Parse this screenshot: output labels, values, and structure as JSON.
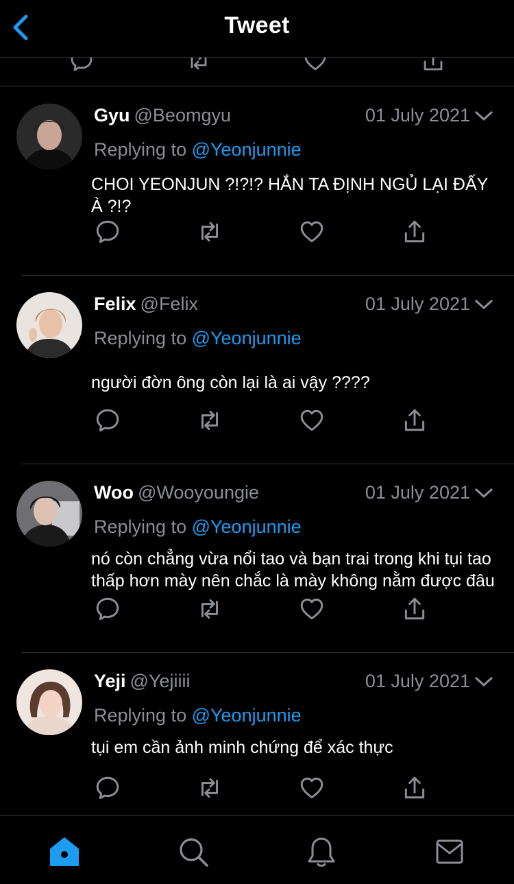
{
  "header": {
    "title": "Tweet"
  },
  "colors": {
    "accent": "#1d9bf0",
    "muted": "#8b8f94",
    "background": "#000000"
  },
  "icons": {
    "back": "chevron-left-icon",
    "reply": "reply-icon",
    "retweet": "retweet-icon",
    "like": "heart-icon",
    "share": "share-icon",
    "more": "chevron-down-icon"
  },
  "tweets": [
    {
      "name": "Gyu",
      "handle": "@Beomgyu",
      "date": "01 July 2021",
      "replying_prefix": "Replying to ",
      "replying_to": "@Yeonjunnie",
      "text": "CHOI YEONJUN ?!?!? HẮN TA ĐỊNH NGỦ LẠI ĐẤY À ?!?"
    },
    {
      "name": "Felix",
      "handle": "@Felix",
      "date": "01 July 2021",
      "replying_prefix": "Replying to ",
      "replying_to": "@Yeonjunnie",
      "text": "người đờn ông còn lại là ai vậy ????"
    },
    {
      "name": "Woo",
      "handle": "@Wooyoungie",
      "date": "01 July 2021",
      "replying_prefix": "Replying to ",
      "replying_to": "@Yeonjunnie",
      "text": "nó còn chẳng vừa nổi tao và bạn trai trong khi tụi tao thấp hơn mày nên chắc là mày không nằm được đâu"
    },
    {
      "name": "Yeji",
      "handle": "@Yejiiii",
      "date": "01 July 2021",
      "replying_prefix": "Replying to ",
      "replying_to": "@Yeonjunnie",
      "text": "tụi em cần ảnh minh chứng để xác thực"
    }
  ],
  "tabbar": {
    "tabs": [
      "home-icon",
      "search-icon",
      "notifications-icon",
      "messages-icon"
    ],
    "active": "home-icon"
  }
}
